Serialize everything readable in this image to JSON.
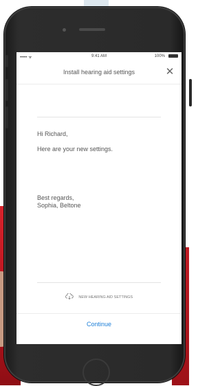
{
  "status": {
    "signal": "•••••  ᯤ",
    "time": "9:41 AM",
    "battery": "100%"
  },
  "nav": {
    "title": "Install hearing aid settings",
    "close_glyph": "✕"
  },
  "message": {
    "greeting": "Hi Richard,",
    "body": "Here are your new settings.",
    "closing": "Best regards,",
    "signature": "Sophia, Beltone"
  },
  "settings": {
    "label": "NEW HEARING AID SETTINGS",
    "icon": "cloud-download-icon"
  },
  "actions": {
    "continue_label": "Continue"
  },
  "colors": {
    "accent": "#1d7fd8",
    "text": "#555555",
    "phone": "#2a2a2a",
    "background_red": "#c11c24"
  }
}
